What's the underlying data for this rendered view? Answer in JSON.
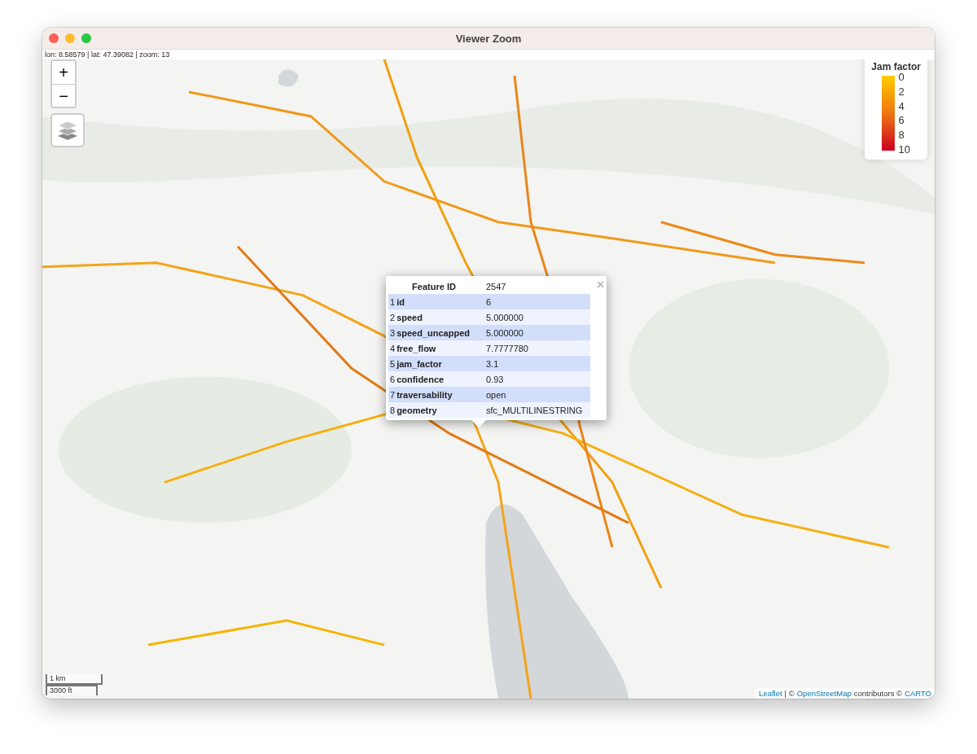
{
  "window": {
    "title": "Viewer Zoom"
  },
  "status": "lon: 8.58579 | lat: 47.39082 | zoom: 13",
  "zoom_controls": [
    "+",
    "−"
  ],
  "legend": {
    "title": "Jam factor",
    "ticks": [
      "0",
      "2",
      "4",
      "6",
      "8",
      "10"
    ]
  },
  "popup": {
    "header": [
      "Feature ID",
      "2547"
    ],
    "close": "×",
    "rows": [
      {
        "index": "1",
        "field": "id",
        "value": "6"
      },
      {
        "index": "2",
        "field": "speed",
        "value": "5.000000"
      },
      {
        "index": "3",
        "field": "speed_uncapped",
        "value": "5.000000"
      },
      {
        "index": "4",
        "field": "free_flow",
        "value": "7.7777780"
      },
      {
        "index": "5",
        "field": "jam_factor",
        "value": "3.1"
      },
      {
        "index": "6",
        "field": "confidence",
        "value": "0.93"
      },
      {
        "index": "7",
        "field": "traversability",
        "value": "open"
      },
      {
        "index": "8",
        "field": "geometry",
        "value": "sfc_MULTILINESTRING"
      }
    ]
  },
  "scale": [
    "1 km",
    "3000 ft"
  ],
  "attribution": [
    {
      "text": "Leaflet",
      "kind": "link"
    },
    {
      "text": "| ©",
      "kind": "text"
    },
    {
      "text": "OpenStreetMap",
      "kind": "link"
    },
    {
      "text": "contributors ©",
      "kind": "text"
    },
    {
      "text": "CARTO",
      "kind": "link"
    }
  ]
}
